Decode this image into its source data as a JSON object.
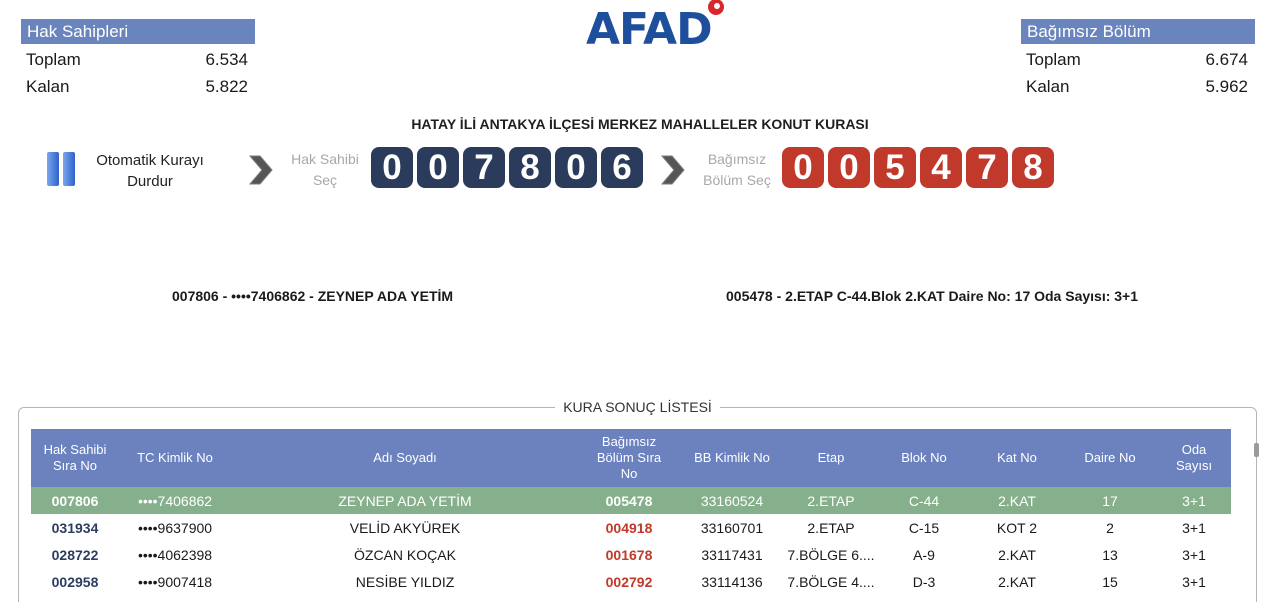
{
  "left_stats": {
    "title": "Hak Sahipleri",
    "rows": [
      {
        "label": "Toplam",
        "value": "6.534"
      },
      {
        "label": "Kalan",
        "value": "5.822"
      }
    ]
  },
  "right_stats": {
    "title": "Bağımsız Bölüm",
    "rows": [
      {
        "label": "Toplam",
        "value": "6.674"
      },
      {
        "label": "Kalan",
        "value": "5.962"
      }
    ]
  },
  "logo": {
    "text": "AFAD"
  },
  "title": "HATAY İLİ ANTAKYA İLÇESİ MERKEZ MAHALLELER KONUT KURASI",
  "controls": {
    "pause_label_1": "Otomatik Kurayı",
    "pause_label_2": "Durdur",
    "owner_label_1": "Hak Sahibi",
    "owner_label_2": "Seç",
    "unit_label_1": "Bağımsız",
    "unit_label_2": "Bölüm Seç",
    "owner_digits": [
      "0",
      "0",
      "7",
      "8",
      "0",
      "6"
    ],
    "unit_digits": [
      "0",
      "0",
      "5",
      "4",
      "7",
      "8"
    ]
  },
  "results": {
    "owner": "007806 - ••••7406862 - ZEYNEP ADA YETİM",
    "unit": "005478 - 2.ETAP C-44.Blok 2.KAT Daire No: 17 Oda Sayısı: 3+1"
  },
  "list": {
    "title": "KURA SONUÇ LİSTESİ",
    "headers": [
      {
        "l1": "Hak Sahibi",
        "l2": "Sıra No",
        "l3": ""
      },
      {
        "l1": "TC Kimlik No",
        "l2": "",
        "l3": ""
      },
      {
        "l1": "Adı Soyadı",
        "l2": "",
        "l3": ""
      },
      {
        "l1": "Bağımsız",
        "l2": "Bölüm Sıra",
        "l3": "No"
      },
      {
        "l1": "BB Kimlik No",
        "l2": "",
        "l3": ""
      },
      {
        "l1": "Etap",
        "l2": "",
        "l3": ""
      },
      {
        "l1": "Blok No",
        "l2": "",
        "l3": ""
      },
      {
        "l1": "Kat No",
        "l2": "",
        "l3": ""
      },
      {
        "l1": "Daire No",
        "l2": "",
        "l3": ""
      },
      {
        "l1": "Oda",
        "l2": "Sayısı",
        "l3": ""
      }
    ],
    "rows": [
      [
        "007806",
        "••••7406862",
        "ZEYNEP ADA YETİM",
        "005478",
        "33160524",
        "2.ETAP",
        "C-44",
        "2.KAT",
        "17",
        "3+1"
      ],
      [
        "031934",
        "••••9637900",
        "VELİD AKYÜREK",
        "004918",
        "33160701",
        "2.ETAP",
        "C-15",
        "KOT 2",
        "2",
        "3+1"
      ],
      [
        "028722",
        "••••4062398",
        "ÖZCAN KOÇAK",
        "001678",
        "33117431",
        "7.BÖLGE 6....",
        "A-9",
        "2.KAT",
        "13",
        "3+1"
      ],
      [
        "002958",
        "••••9007418",
        "NESİBE YILDIZ",
        "002792",
        "33114136",
        "7.BÖLGE 4....",
        "D-3",
        "2.KAT",
        "15",
        "3+1"
      ]
    ]
  },
  "colors": {
    "header_blue": "#6b82bf",
    "digit_blue": "#2b3b5c",
    "digit_red": "#c0392b",
    "highlight_green": "#86af8b",
    "logo_blue": "#1d4f9c"
  }
}
